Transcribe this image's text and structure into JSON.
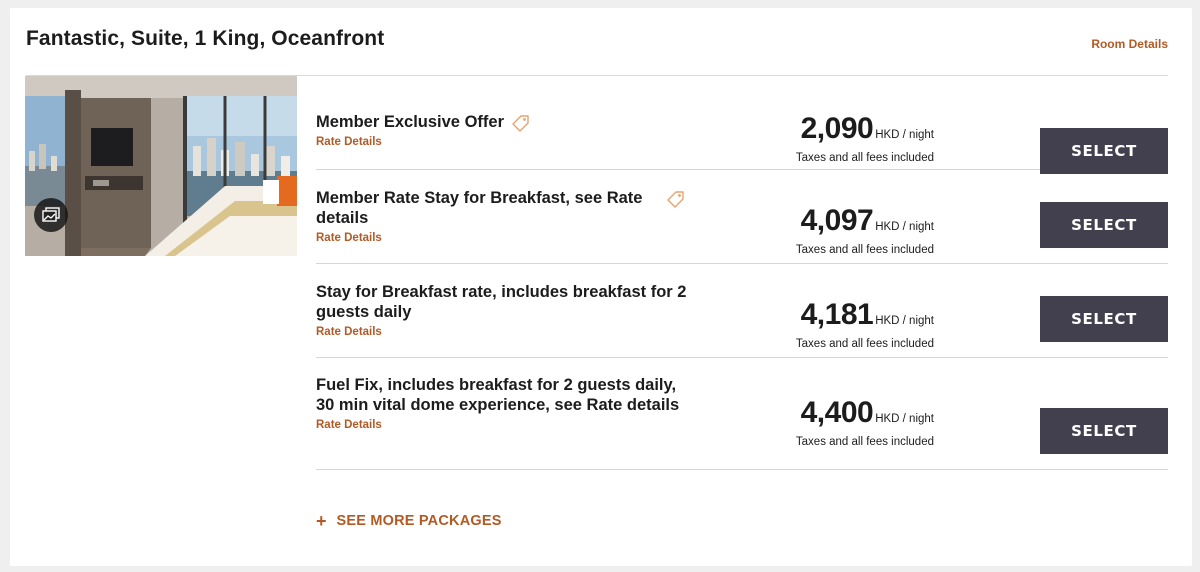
{
  "room": {
    "title": "Fantastic, Suite, 1 King, Oceanfront",
    "details_link": "Room Details",
    "photo_icon": "gallery-icon"
  },
  "rates": [
    {
      "name": "Member Exclusive Offer",
      "details_link": "Rate Details",
      "tag_icon": "tag-icon",
      "price": "2,090",
      "unit": "HKD / night",
      "tax_note": "Taxes and all fees included",
      "select_label": "SELECT"
    },
    {
      "name": "Member Rate Stay for Breakfast, see Rate details",
      "details_link": "Rate Details",
      "tag_icon": "tag-icon",
      "price": "4,097",
      "unit": "HKD / night",
      "tax_note": "Taxes and all fees included",
      "select_label": "SELECT"
    },
    {
      "name": "Stay for Breakfast rate, includes breakfast for 2 guests daily",
      "details_link": "Rate Details",
      "price": "4,181",
      "unit": "HKD / night",
      "tax_note": "Taxes and all fees included",
      "select_label": "SELECT"
    },
    {
      "name": "Fuel Fix, includes breakfast for 2 guests daily, 30 min vital dome experience, see Rate details",
      "details_link": "Rate Details",
      "price": "4,400",
      "unit": "HKD / night",
      "tax_note": "Taxes and all fees included",
      "select_label": "SELECT"
    }
  ],
  "see_more": {
    "icon": "+",
    "label": "SEE MORE PACKAGES"
  },
  "colors": {
    "accent": "#b25a24",
    "button": "#42404f",
    "text": "#1c1c1c",
    "divider": "#d6d6d6",
    "background": "#efefef"
  }
}
